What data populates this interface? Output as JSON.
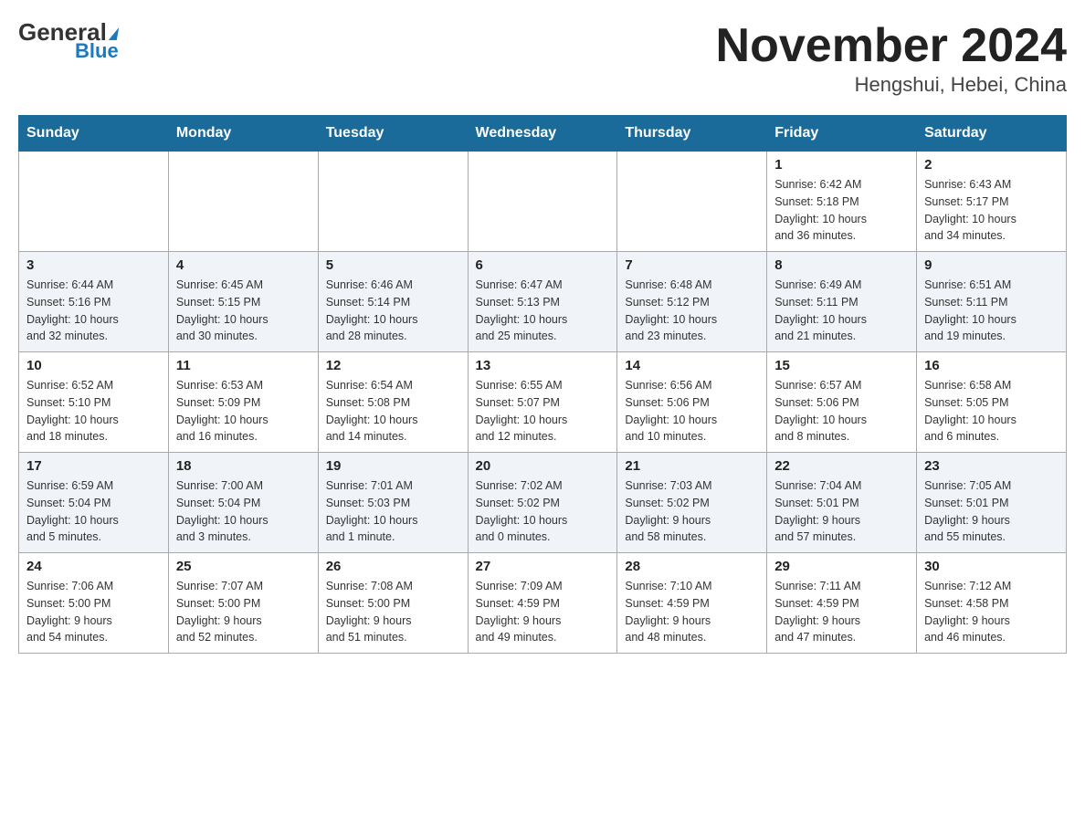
{
  "header": {
    "logo_general": "General",
    "logo_blue": "Blue",
    "month_title": "November 2024",
    "location": "Hengshui, Hebei, China"
  },
  "weekdays": [
    "Sunday",
    "Monday",
    "Tuesday",
    "Wednesday",
    "Thursday",
    "Friday",
    "Saturday"
  ],
  "weeks": [
    [
      {
        "day": "",
        "info": ""
      },
      {
        "day": "",
        "info": ""
      },
      {
        "day": "",
        "info": ""
      },
      {
        "day": "",
        "info": ""
      },
      {
        "day": "",
        "info": ""
      },
      {
        "day": "1",
        "info": "Sunrise: 6:42 AM\nSunset: 5:18 PM\nDaylight: 10 hours\nand 36 minutes."
      },
      {
        "day": "2",
        "info": "Sunrise: 6:43 AM\nSunset: 5:17 PM\nDaylight: 10 hours\nand 34 minutes."
      }
    ],
    [
      {
        "day": "3",
        "info": "Sunrise: 6:44 AM\nSunset: 5:16 PM\nDaylight: 10 hours\nand 32 minutes."
      },
      {
        "day": "4",
        "info": "Sunrise: 6:45 AM\nSunset: 5:15 PM\nDaylight: 10 hours\nand 30 minutes."
      },
      {
        "day": "5",
        "info": "Sunrise: 6:46 AM\nSunset: 5:14 PM\nDaylight: 10 hours\nand 28 minutes."
      },
      {
        "day": "6",
        "info": "Sunrise: 6:47 AM\nSunset: 5:13 PM\nDaylight: 10 hours\nand 25 minutes."
      },
      {
        "day": "7",
        "info": "Sunrise: 6:48 AM\nSunset: 5:12 PM\nDaylight: 10 hours\nand 23 minutes."
      },
      {
        "day": "8",
        "info": "Sunrise: 6:49 AM\nSunset: 5:11 PM\nDaylight: 10 hours\nand 21 minutes."
      },
      {
        "day": "9",
        "info": "Sunrise: 6:51 AM\nSunset: 5:11 PM\nDaylight: 10 hours\nand 19 minutes."
      }
    ],
    [
      {
        "day": "10",
        "info": "Sunrise: 6:52 AM\nSunset: 5:10 PM\nDaylight: 10 hours\nand 18 minutes."
      },
      {
        "day": "11",
        "info": "Sunrise: 6:53 AM\nSunset: 5:09 PM\nDaylight: 10 hours\nand 16 minutes."
      },
      {
        "day": "12",
        "info": "Sunrise: 6:54 AM\nSunset: 5:08 PM\nDaylight: 10 hours\nand 14 minutes."
      },
      {
        "day": "13",
        "info": "Sunrise: 6:55 AM\nSunset: 5:07 PM\nDaylight: 10 hours\nand 12 minutes."
      },
      {
        "day": "14",
        "info": "Sunrise: 6:56 AM\nSunset: 5:06 PM\nDaylight: 10 hours\nand 10 minutes."
      },
      {
        "day": "15",
        "info": "Sunrise: 6:57 AM\nSunset: 5:06 PM\nDaylight: 10 hours\nand 8 minutes."
      },
      {
        "day": "16",
        "info": "Sunrise: 6:58 AM\nSunset: 5:05 PM\nDaylight: 10 hours\nand 6 minutes."
      }
    ],
    [
      {
        "day": "17",
        "info": "Sunrise: 6:59 AM\nSunset: 5:04 PM\nDaylight: 10 hours\nand 5 minutes."
      },
      {
        "day": "18",
        "info": "Sunrise: 7:00 AM\nSunset: 5:04 PM\nDaylight: 10 hours\nand 3 minutes."
      },
      {
        "day": "19",
        "info": "Sunrise: 7:01 AM\nSunset: 5:03 PM\nDaylight: 10 hours\nand 1 minute."
      },
      {
        "day": "20",
        "info": "Sunrise: 7:02 AM\nSunset: 5:02 PM\nDaylight: 10 hours\nand 0 minutes."
      },
      {
        "day": "21",
        "info": "Sunrise: 7:03 AM\nSunset: 5:02 PM\nDaylight: 9 hours\nand 58 minutes."
      },
      {
        "day": "22",
        "info": "Sunrise: 7:04 AM\nSunset: 5:01 PM\nDaylight: 9 hours\nand 57 minutes."
      },
      {
        "day": "23",
        "info": "Sunrise: 7:05 AM\nSunset: 5:01 PM\nDaylight: 9 hours\nand 55 minutes."
      }
    ],
    [
      {
        "day": "24",
        "info": "Sunrise: 7:06 AM\nSunset: 5:00 PM\nDaylight: 9 hours\nand 54 minutes."
      },
      {
        "day": "25",
        "info": "Sunrise: 7:07 AM\nSunset: 5:00 PM\nDaylight: 9 hours\nand 52 minutes."
      },
      {
        "day": "26",
        "info": "Sunrise: 7:08 AM\nSunset: 5:00 PM\nDaylight: 9 hours\nand 51 minutes."
      },
      {
        "day": "27",
        "info": "Sunrise: 7:09 AM\nSunset: 4:59 PM\nDaylight: 9 hours\nand 49 minutes."
      },
      {
        "day": "28",
        "info": "Sunrise: 7:10 AM\nSunset: 4:59 PM\nDaylight: 9 hours\nand 48 minutes."
      },
      {
        "day": "29",
        "info": "Sunrise: 7:11 AM\nSunset: 4:59 PM\nDaylight: 9 hours\nand 47 minutes."
      },
      {
        "day": "30",
        "info": "Sunrise: 7:12 AM\nSunset: 4:58 PM\nDaylight: 9 hours\nand 46 minutes."
      }
    ]
  ]
}
